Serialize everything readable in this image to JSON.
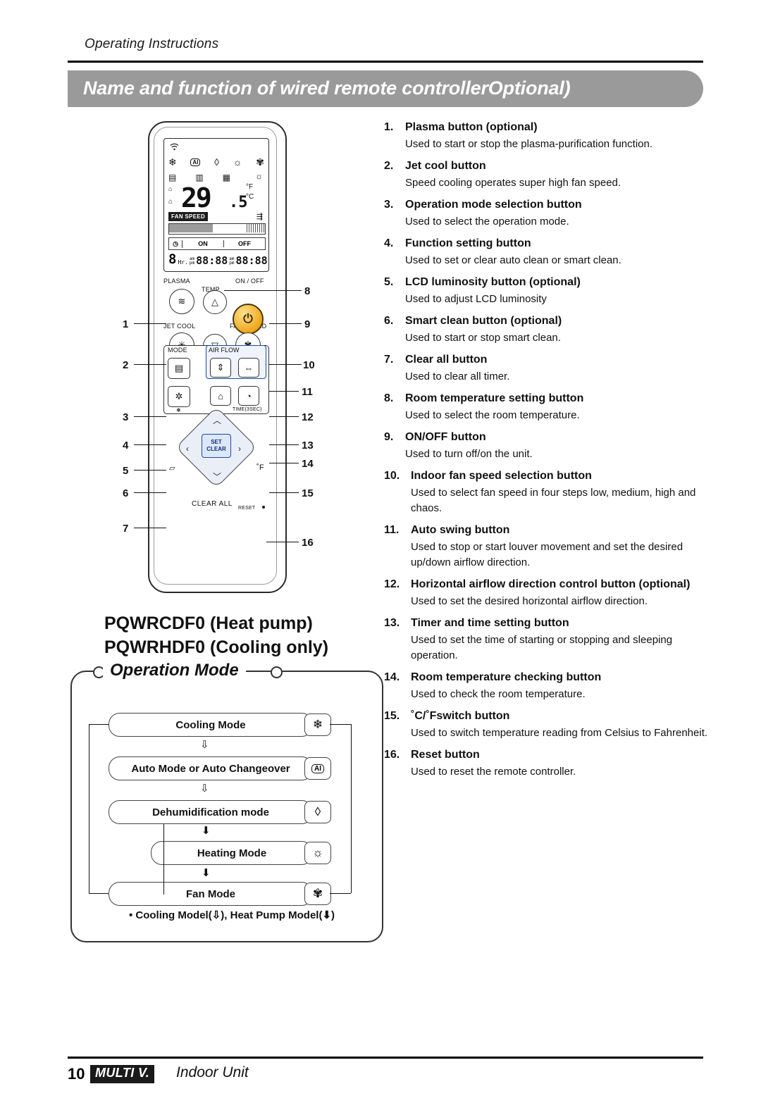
{
  "header": {
    "running_head": "Operating Instructions",
    "title": "Name and function of wired remote controllerOptional)"
  },
  "remote": {
    "lcd": {
      "wifi_icon": "wifi-icon",
      "mode_icons": [
        "snowflake",
        "AI",
        "droplet",
        "sun",
        "fan"
      ],
      "secondary_icons": [
        "filter",
        "plasma",
        "plasma2"
      ],
      "temp_integer": "29",
      "temp_decimal": ".5",
      "unit_f": "°F",
      "unit_c": "°C",
      "fan_speed_label": "FAN SPEED",
      "timer_on": "ON",
      "timer_off": "OFF",
      "timer_hr": "Hr.",
      "timer_big": "8",
      "timer_digits_left": "88:88",
      "timer_digits_right": "88:88",
      "ampm_left": "am pm",
      "ampm_right": "am pm"
    },
    "labels": {
      "plasma": "PLASMA",
      "temp": "TEMP",
      "on_off": "ON / OFF",
      "jet_cool": "JET COOL",
      "fan_speed": "FAN SPEED",
      "mode": "MODE",
      "air_flow": "AIR FLOW",
      "time_sec": "TIME(3SEC)",
      "set": "SET",
      "clear": "CLEAR",
      "clear_all": "CLEAR ALL",
      "reset": "RESET",
      "f_mark": "˚F"
    },
    "callouts": [
      "1",
      "2",
      "3",
      "4",
      "5",
      "6",
      "7",
      "8",
      "9",
      "10",
      "11",
      "12",
      "13",
      "14",
      "15",
      "16"
    ]
  },
  "model": {
    "line1": "PQWRCDF0 (Heat pump)",
    "line2": "PQWRHDF0 (Cooling only)"
  },
  "operation_mode": {
    "heading": "Operation Mode",
    "steps": [
      {
        "label": "Cooling Mode",
        "icon": "snowflake-icon"
      },
      {
        "label": "Auto Mode or Auto Changeover",
        "icon": "ai-icon"
      },
      {
        "label": "Dehumidification mode",
        "icon": "droplet-icon"
      },
      {
        "label": "Heating Mode",
        "icon": "sun-icon"
      },
      {
        "label": "Fan Mode",
        "icon": "fan-icon"
      }
    ],
    "note": "• Cooling Model(⇩), Heat Pump Model(⬇)"
  },
  "descriptions": [
    {
      "num": "1.",
      "title": "Plasma button (optional)",
      "body": "Used to start or stop the plasma-purification function."
    },
    {
      "num": "2.",
      "title": "Jet cool button",
      "body": "Speed cooling operates super high fan speed."
    },
    {
      "num": "3.",
      "title": "Operation mode selection button",
      "body": "Used to select the operation mode."
    },
    {
      "num": "4.",
      "title": "Function setting button",
      "body": "Used to set or clear auto clean or smart clean."
    },
    {
      "num": "5.",
      "title": "LCD luminosity button (optional)",
      "body": "Used to adjust LCD luminosity"
    },
    {
      "num": "6.",
      "title": "Smart clean button (optional)",
      "body": "Used to start or stop smart clean."
    },
    {
      "num": "7.",
      "title": "Clear all button",
      "body": "Used to clear all timer."
    },
    {
      "num": "8.",
      "title": "Room temperature setting button",
      "body": "Used to select the room temperature."
    },
    {
      "num": "9.",
      "title": "ON/OFF button",
      "body": "Used to turn off/on the unit."
    },
    {
      "num": "10.",
      "title": "Indoor fan speed selection button",
      "body": "Used to select fan speed in four steps low, medium, high and chaos."
    },
    {
      "num": "11.",
      "title": "Auto swing button",
      "body": "Used to stop or start louver movement and set the desired up/down airflow direction."
    },
    {
      "num": "12.",
      "title": "Horizontal airflow direction control button (optional)",
      "body": "Used to set the desired horizontal airflow direction."
    },
    {
      "num": "13.",
      "title": "Timer and time setting button",
      "body": "Used to set the time of starting or stopping and sleeping operation."
    },
    {
      "num": "14.",
      "title": "Room temperature checking button",
      "body": "Used to check the room temperature."
    },
    {
      "num": "15.",
      "title": "˚C/˚Fswitch button",
      "body": "Used to switch temperature reading from Celsius to Fahrenheit."
    },
    {
      "num": "16.",
      "title": "Reset button",
      "body": "Used to reset the remote controller."
    }
  ],
  "footer": {
    "page": "10",
    "brand": "MULTI V.",
    "text": "Indoor Unit"
  }
}
